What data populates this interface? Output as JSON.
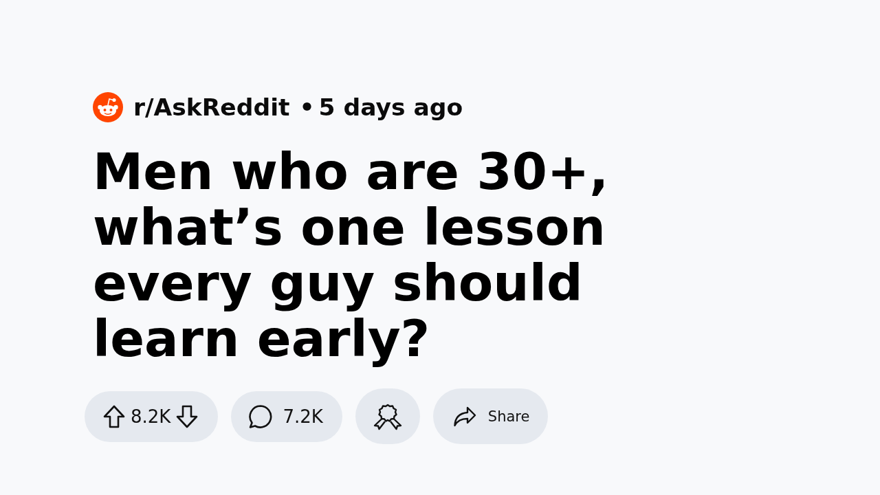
{
  "post": {
    "subreddit": "r/AskReddit",
    "separator": "•",
    "age": "5 days ago",
    "title": "Men who are 30+, what’s one lesson every guy should learn early?"
  },
  "actions": [
    {
      "kind": "vote",
      "count": "8.2K"
    },
    {
      "kind": "comments",
      "count": "7.2K"
    },
    {
      "kind": "award"
    },
    {
      "kind": "share",
      "label": "Share"
    }
  ]
}
